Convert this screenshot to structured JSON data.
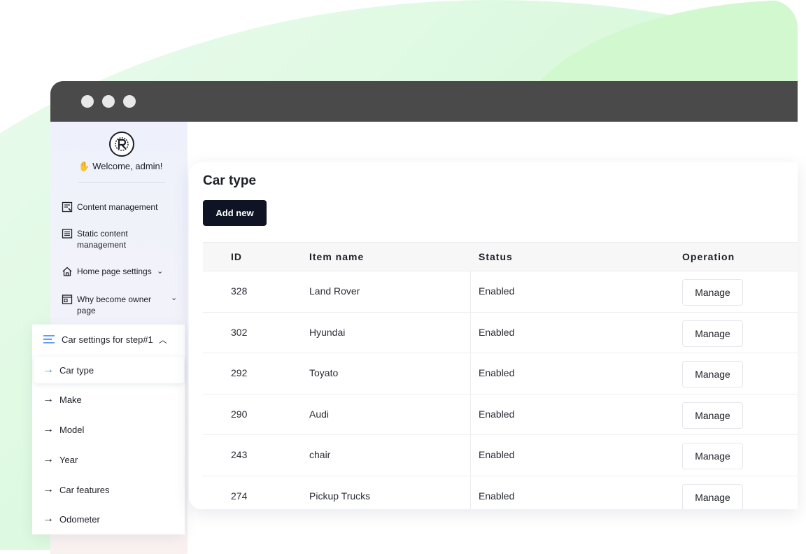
{
  "sidebar": {
    "welcome": "Welcome, admin!",
    "nav_items": [
      {
        "label": "Content management",
        "icon": "content-edit-icon"
      },
      {
        "label": "Static content management",
        "icon": "document-list-icon"
      },
      {
        "label": "Home page settings",
        "icon": "home-icon"
      },
      {
        "label": "Why become owner page",
        "icon": "browser-page-icon"
      }
    ],
    "group": {
      "label": "Car settings for step#1",
      "items": [
        "Car type",
        "Make",
        "Model",
        "Year",
        "Car features",
        "Odometer"
      ],
      "active_index": 0
    }
  },
  "panel": {
    "title": "Car type",
    "add_label": "Add new",
    "columns": [
      "ID",
      "Item name",
      "Status",
      "Operation"
    ],
    "rows": [
      {
        "id": "328",
        "name": "Land Rover",
        "status": "Enabled",
        "action": "Manage"
      },
      {
        "id": "302",
        "name": "Hyundai",
        "status": "Enabled",
        "action": "Manage"
      },
      {
        "id": "292",
        "name": "Toyato",
        "status": "Enabled",
        "action": "Manage"
      },
      {
        "id": "290",
        "name": "Audi",
        "status": "Enabled",
        "action": "Manage"
      },
      {
        "id": "243",
        "name": "chair",
        "status": "Enabled",
        "action": "Manage"
      },
      {
        "id": "274",
        "name": "Pickup Trucks",
        "status": "Enabled",
        "action": "Manage"
      }
    ]
  },
  "colors": {
    "titlebar": "#4a4a4a",
    "primary_button": "#0f1424",
    "active_arrow": "#3b82f6",
    "background_green": "#d2f8cf"
  }
}
